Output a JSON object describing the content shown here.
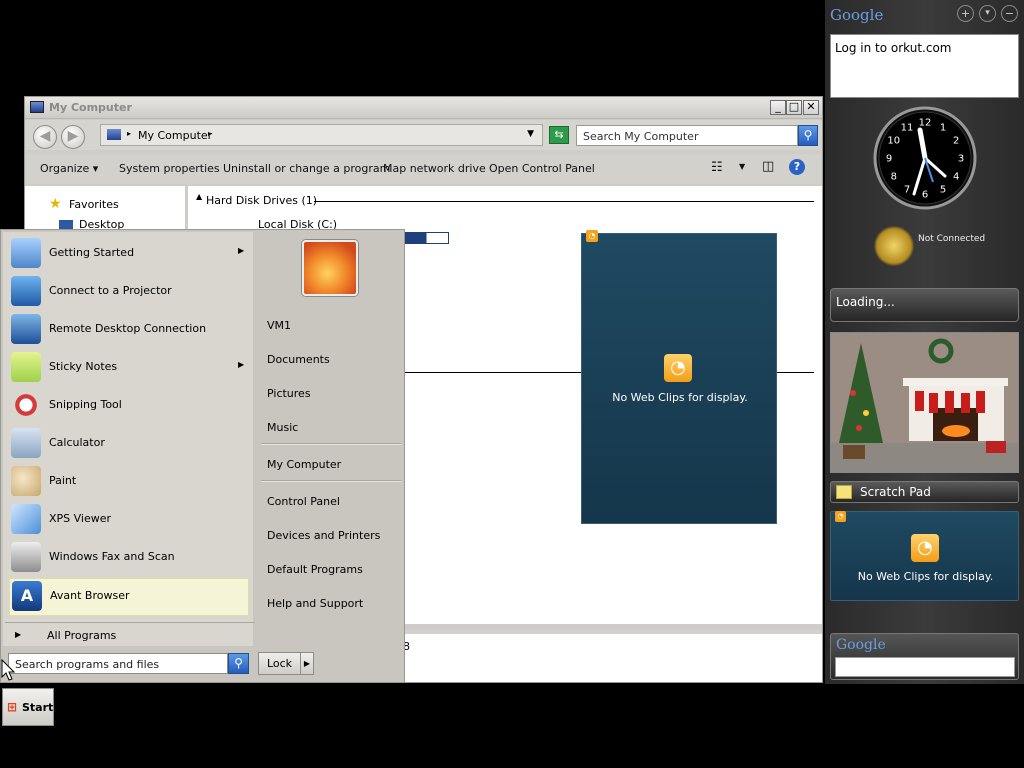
{
  "window": {
    "title": "My Computer",
    "address": "My Computer",
    "search_placeholder": "Search My Computer",
    "commands": [
      "Organize",
      "System properties",
      "Uninstall or change a program",
      "Map network drive",
      "Open Control Panel"
    ],
    "nav": {
      "favorites": "Favorites",
      "desktop": "Desktop"
    },
    "group_header": "Hard Disk Drives (1)",
    "disk_label": "Local Disk (C:)",
    "status_fragment": "8"
  },
  "start_menu": {
    "programs": [
      {
        "label": "Getting Started",
        "icon": "getting-started-icon",
        "submenu": true
      },
      {
        "label": "Connect to a Projector",
        "icon": "projector-icon",
        "submenu": false
      },
      {
        "label": "Remote Desktop Connection",
        "icon": "remote-desktop-icon",
        "submenu": false
      },
      {
        "label": "Sticky Notes",
        "icon": "sticky-notes-icon",
        "submenu": true
      },
      {
        "label": "Snipping Tool",
        "icon": "snipping-tool-icon",
        "submenu": false
      },
      {
        "label": "Calculator",
        "icon": "calculator-icon",
        "submenu": false
      },
      {
        "label": "Paint",
        "icon": "paint-icon",
        "submenu": false
      },
      {
        "label": "XPS Viewer",
        "icon": "xps-viewer-icon",
        "submenu": false
      },
      {
        "label": "Windows Fax and Scan",
        "icon": "fax-scan-icon",
        "submenu": false
      },
      {
        "label": "Avant Browser",
        "icon": "avant-browser-icon",
        "submenu": false
      }
    ],
    "all_programs": "All Programs",
    "search_placeholder": "Search programs and files",
    "lock_label": "Lock",
    "right_links": [
      "VM1",
      "Documents",
      "Pictures",
      "Music",
      "My Computer",
      "Control Panel",
      "Devices and Printers",
      "Default Programs",
      "Help and Support"
    ]
  },
  "webclip_main": {
    "message": "No Web Clips for display."
  },
  "sidebar": {
    "google_title": "Google",
    "orkut_text": "Log in to orkut.com",
    "clock_numbers": [
      "12",
      "1",
      "2",
      "3",
      "4",
      "5",
      "6",
      "7",
      "8",
      "9",
      "10",
      "11"
    ],
    "weather_status": "Not Connected",
    "loading_text": "Loading...",
    "scratch_pad": "Scratch Pad",
    "webclip_message": "No Web Clips for display.",
    "google_search_title": "Google"
  },
  "taskbar": {
    "start_label": "Start"
  },
  "colors": {
    "accent_blue": "#245cbd",
    "clip_bg": "#1f4a62",
    "sidebar_bg": "#333333"
  }
}
